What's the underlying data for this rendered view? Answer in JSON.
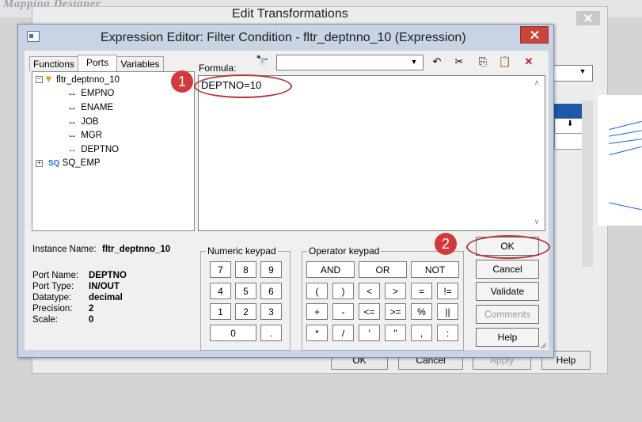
{
  "background": {
    "designer_title": "Mapping Designer",
    "window_title": "Edit Transformations",
    "buttons": [
      "OK",
      "Cancel",
      "Apply",
      "Help"
    ]
  },
  "dialog": {
    "title": "Expression Editor: Filter Condition - fltr_deptnno_10 (Expression)",
    "tabs": [
      "Functions",
      "Ports",
      "Variables"
    ],
    "active_tab": "Ports",
    "tree": {
      "root": "fltr_deptnno_10",
      "ports": [
        "EMPNO",
        "ENAME",
        "JOB",
        "MGR",
        "DEPTNO"
      ],
      "selected_port": "DEPTNO",
      "second_root": "SQ_EMP"
    },
    "instance_name_label": "Instance Name:",
    "instance_name_value": "fltr_deptnno_10",
    "port_info": [
      {
        "label": "Port Name:",
        "value": "DEPTNO"
      },
      {
        "label": "Port Type:",
        "value": "IN/OUT"
      },
      {
        "label": "Datatype:",
        "value": "decimal"
      },
      {
        "label": "Precision:",
        "value": "2"
      },
      {
        "label": "Scale:",
        "value": "0"
      }
    ],
    "formula_label": "Formula:",
    "formula_combo_value": "",
    "formula_text": "DEPTNO=10",
    "numeric_keypad_label": "Numeric keypad",
    "numeric_keys": [
      "7",
      "8",
      "9",
      "4",
      "5",
      "6",
      "1",
      "2",
      "3",
      "0",
      "."
    ],
    "operator_keypad_label": "Operator keypad",
    "operator_keys_row1": [
      "AND",
      "OR",
      "NOT"
    ],
    "operator_keys": [
      "(",
      ")",
      "<",
      ">",
      "=",
      "!=",
      "+",
      "-",
      "<=",
      ">=",
      "%",
      "||",
      "*",
      "/",
      "'",
      "\"",
      ",",
      ":"
    ],
    "buttons": {
      "ok": "OK",
      "cancel": "Cancel",
      "validate": "Validate",
      "comments": "Comments",
      "help": "Help"
    }
  },
  "annotations": {
    "badge1": "1",
    "badge2": "2",
    "color": "#d2393a"
  }
}
